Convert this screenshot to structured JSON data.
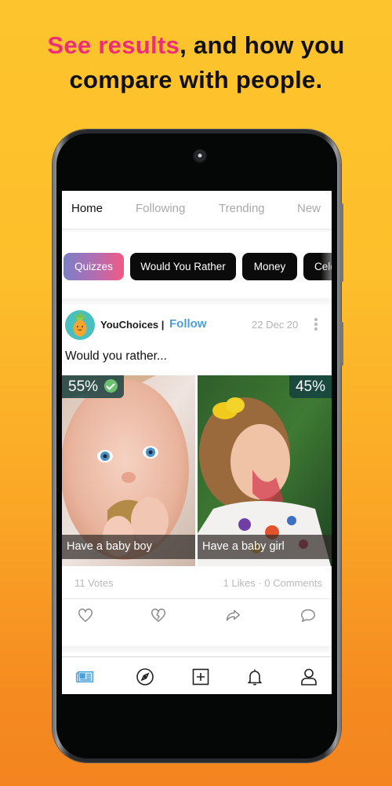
{
  "headline": {
    "accent_text": "See results",
    "rest_line1": ", and how you",
    "line2": "compare with people.",
    "accent_color": "#EC2F78"
  },
  "tabs": [
    {
      "label": "Home",
      "active": true
    },
    {
      "label": "Following",
      "active": false
    },
    {
      "label": "Trending",
      "active": false
    },
    {
      "label": "New",
      "active": false
    }
  ],
  "categories": [
    {
      "label": "Quizzes",
      "selected": true
    },
    {
      "label": "Would You Rather",
      "selected": false
    },
    {
      "label": "Money",
      "selected": false
    },
    {
      "label": "Cele",
      "selected": false
    }
  ],
  "post": {
    "author": "YouChoices |",
    "follow_label": "Follow",
    "date": "22 Dec 20",
    "avatar_icon": "pineapple-icon",
    "question": "Would you rather...",
    "choices": [
      {
        "label": "Have a baby boy",
        "percent": "55%",
        "winner": true,
        "image": "baby-boy-photo"
      },
      {
        "label": "Have a baby girl",
        "percent": "45%",
        "winner": false,
        "image": "baby-girl-photo"
      }
    ],
    "votes": "11 Votes",
    "likes_comments": "1 Likes · 0 Comments",
    "actions": [
      "heart-icon",
      "broken-heart-icon",
      "share-icon",
      "comment-icon"
    ]
  },
  "bottom_nav": [
    {
      "icon": "feed-icon",
      "active": true
    },
    {
      "icon": "explore-icon",
      "active": false
    },
    {
      "icon": "add-icon",
      "active": false
    },
    {
      "icon": "bell-icon",
      "active": false
    },
    {
      "icon": "profile-icon",
      "active": false
    }
  ],
  "colors": {
    "follow": "#4A9FD6",
    "active_nav": "#4A9FD6",
    "winner_check": "#6CC16E",
    "percent_badge": "#123E40"
  }
}
